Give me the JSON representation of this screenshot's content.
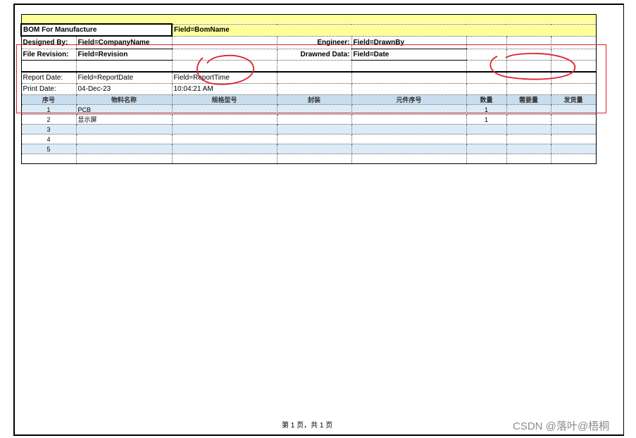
{
  "report": {
    "title": "BOM For Manufacture",
    "bom_name": "Field=BomName",
    "designed_by_label": "Designed By:",
    "designed_by_value": "Field=CompanyName",
    "engineer_label": "Engineer:",
    "engineer_value": "Field=DrawnBy",
    "file_revision_label": "File Revision:",
    "file_revision_value": "Field=Revision",
    "drawned_data_label": "Drawned Data:",
    "drawned_data_value": "Field=Date",
    "report_date_label": "Report Date:",
    "report_date_value": "Field=ReportDate",
    "report_time_value": "Field=ReportTime",
    "print_date_label": "Print Date:",
    "print_date_value": "04-Dec-23",
    "print_time_value": "10:04:21 AM"
  },
  "table": {
    "columns": [
      "序号",
      "物料名称",
      "规格型号",
      "封装",
      "元件序号",
      "数量",
      "需要量",
      "发货量"
    ],
    "rows": [
      {
        "no": "1",
        "name": "PCB",
        "qty": "1"
      },
      {
        "no": "2",
        "name": "显示屏",
        "qty": "1"
      },
      {
        "no": "3",
        "name": "",
        "qty": ""
      },
      {
        "no": "4",
        "name": "",
        "qty": ""
      },
      {
        "no": "5",
        "name": "",
        "qty": ""
      }
    ]
  },
  "footer": {
    "page_label": "第 1 页，共 1 页"
  },
  "watermark": "CSDN @落叶@梧桐",
  "colors": {
    "annotation": "#e02030",
    "header_fill": "#ffff99",
    "table_header": "#c8ddee"
  }
}
